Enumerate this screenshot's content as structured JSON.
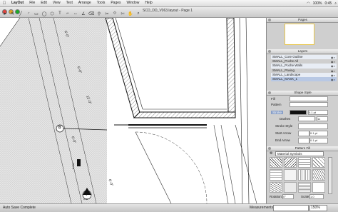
{
  "menubar": {
    "apple": "",
    "items": [
      "LayOut",
      "File",
      "Edit",
      "View",
      "Text",
      "Arrange",
      "Tools",
      "Pages",
      "Window",
      "Help"
    ],
    "status": {
      "battery": "100%",
      "clock": "0:45"
    }
  },
  "window": {
    "title": "SCD_DD_V063.layout - Page 1"
  },
  "panels": {
    "pages": {
      "title": "Pages"
    },
    "layers": {
      "title": "Layers",
      "items": [
        "SMALL_Core Outline",
        "SMALL_Poche All",
        "SMALL_Poche Walls",
        "SMALL_Paving",
        "SMALL_Landscape",
        "SMALL_MASK_1"
      ]
    },
    "shape_style": {
      "title": "Shape Style",
      "fill": "Fill",
      "pattern": "Pattern",
      "stroke": "Stroke",
      "stroke_value": "0.1 pt",
      "dashes": "Dashes",
      "dashes_value": "1x",
      "stroke_style": "Stroke Style",
      "start_arrow": "Start Arrow",
      "start_arrow_value": "0.1 pt",
      "end_arrow": "End Arrow",
      "end_arrow_value": "0.1 pt"
    },
    "pattern_fill": {
      "title": "Pattern Fill",
      "material": "Material Symbols",
      "rotation_label": "Rotation:",
      "rotation_value": "0°",
      "scale_label": "Scale:",
      "scale_value": "1.0"
    }
  },
  "statusbar": {
    "left": "Auto Save Complete",
    "measurements_label": "Measurements",
    "zoom": "150%"
  },
  "drawing": {
    "labels": [
      "6'-0\"",
      "6'-0\"",
      "11'-0\"",
      "6'-0\"",
      "A401",
      "B",
      "6'-0\"",
      "1",
      "A411"
    ]
  }
}
